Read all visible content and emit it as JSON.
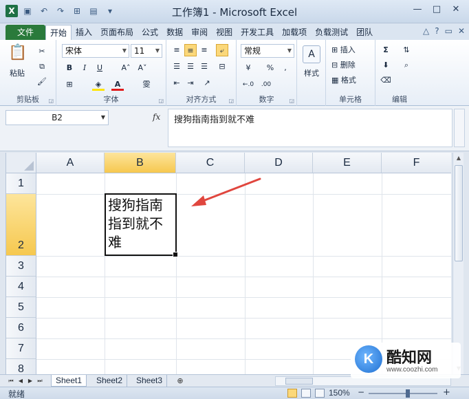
{
  "window": {
    "title": "工作簿1 - Microsoft Excel",
    "app_icon": "X",
    "controls": [
      "—",
      "□",
      "✕"
    ]
  },
  "tabs": {
    "file": "文件",
    "items": [
      "开始",
      "插入",
      "页面布局",
      "公式",
      "数据",
      "审阅",
      "视图",
      "开发工具",
      "加载项",
      "负载测试",
      "团队"
    ],
    "active": "开始"
  },
  "ribbon": {
    "clipboard": {
      "label": "剪贴板",
      "paste": "粘贴"
    },
    "font": {
      "label": "字体",
      "name": "宋体",
      "size": "11",
      "bold": "B",
      "italic": "I",
      "underline": "U",
      "wen": "雯"
    },
    "alignment": {
      "label": "对齐方式"
    },
    "number": {
      "label": "数字",
      "format": "常规",
      "percent": "%"
    },
    "styles": {
      "label": "样式"
    },
    "cells": {
      "insert": "插入",
      "delete": "删除",
      "format": "格式",
      "label": "单元格"
    },
    "editing": {
      "label": "编辑",
      "sum": "Σ"
    }
  },
  "formula_bar": {
    "name_box": "B2",
    "fx": "fx",
    "content": "搜狗指南指到就不难"
  },
  "grid": {
    "columns": [
      "A",
      "B",
      "C",
      "D",
      "E",
      "F"
    ],
    "rows": [
      "1",
      "2",
      "3",
      "4",
      "5",
      "6",
      "7",
      "8"
    ],
    "selected_col": "B",
    "selected_row": "2",
    "cell_b2": "搜狗指南指到就不难"
  },
  "sheets": [
    "Sheet1",
    "Sheet2",
    "Sheet3"
  ],
  "status": {
    "ready": "就绪",
    "zoom": "150%",
    "minus": "−",
    "plus": "+"
  },
  "watermark": {
    "name": "酷知网",
    "url": "www.coozhi.com",
    "logo": "K"
  },
  "colors": {
    "file_tab": "#2a7a3b",
    "selected_header": "#f6c84f",
    "arrow": "#e0463e"
  }
}
